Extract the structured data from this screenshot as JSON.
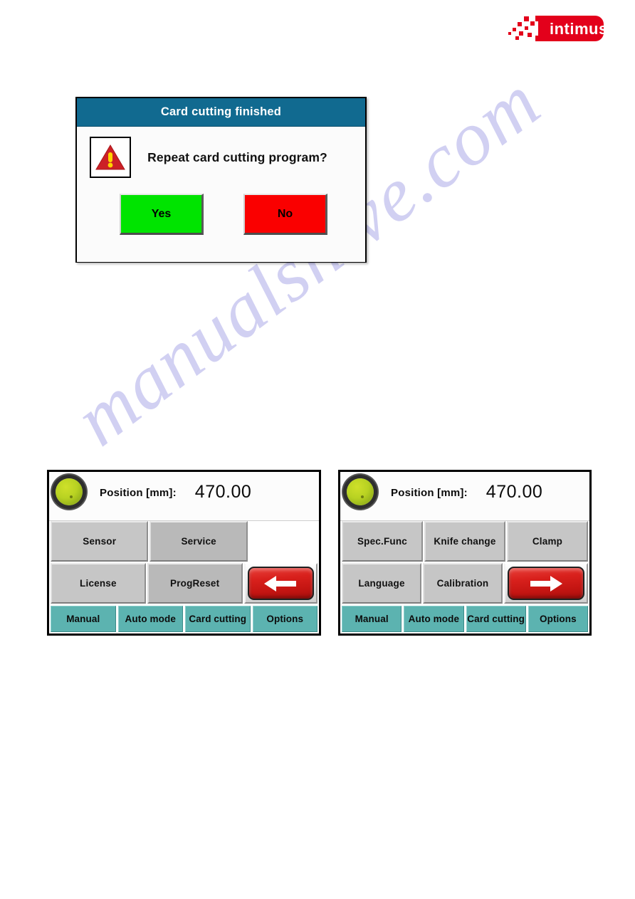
{
  "brand": {
    "logo_text": "intimus",
    "logo_color": "#e3001b"
  },
  "watermark": {
    "text": "manualshive.com",
    "color": "#c9c8f0"
  },
  "dialog": {
    "title": "Card cutting finished",
    "title_bar_color": "#116a90",
    "icon": "warning-triangle-icon",
    "message": "Repeat card cutting program?",
    "buttons": [
      {
        "label": "Yes",
        "color": "#00e400"
      },
      {
        "label": "No",
        "color": "#fa0000"
      }
    ]
  },
  "panels": [
    {
      "id": "left",
      "status_led": {
        "name": "status-led-green",
        "color": "#b8d222"
      },
      "position_label": "Position  [mm]:",
      "position_value": "470.00",
      "rows": [
        [
          {
            "label": "Sensor",
            "type": "function"
          },
          {
            "label": "Service",
            "type": "function"
          },
          {
            "label": "",
            "type": "empty"
          }
        ],
        [
          {
            "label": "License",
            "type": "function"
          },
          {
            "label": "ProgReset",
            "type": "function"
          },
          {
            "label": "",
            "type": "nav",
            "icon": "arrow-left-icon"
          }
        ]
      ],
      "tabs": [
        {
          "label": "Manual"
        },
        {
          "label": "Auto mode"
        },
        {
          "label": "Card cutting"
        },
        {
          "label": "Options"
        }
      ]
    },
    {
      "id": "right",
      "status_led": {
        "name": "status-led-green",
        "color": "#b8d222"
      },
      "position_label": "Position  [mm]:",
      "position_value": "470.00",
      "rows": [
        [
          {
            "label": "Spec.Func",
            "type": "function"
          },
          {
            "label": "Knife change",
            "type": "function"
          },
          {
            "label": "Clamp",
            "type": "function"
          }
        ],
        [
          {
            "label": "Language",
            "type": "function"
          },
          {
            "label": "Calibration",
            "type": "function"
          },
          {
            "label": "",
            "type": "nav",
            "icon": "arrow-right-icon"
          }
        ]
      ],
      "tabs": [
        {
          "label": "Manual"
        },
        {
          "label": "Auto mode"
        },
        {
          "label": "Card cutting"
        },
        {
          "label": "Options"
        }
      ]
    }
  ]
}
